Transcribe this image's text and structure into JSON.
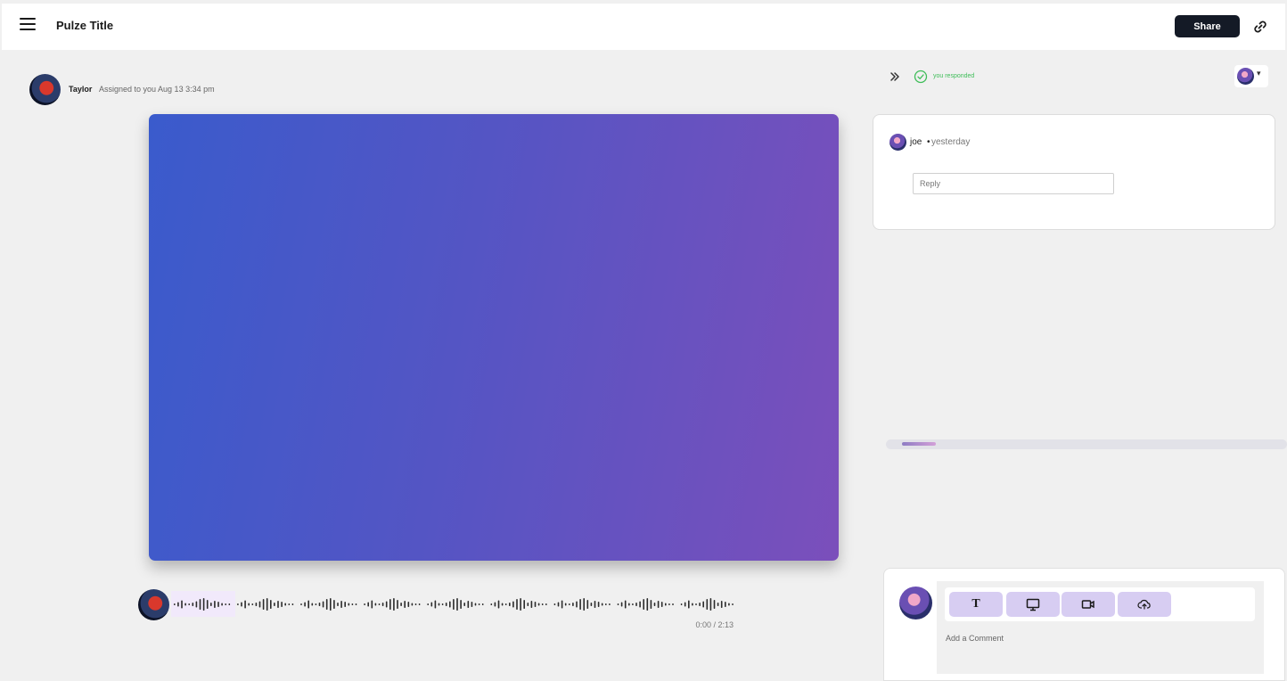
{
  "header": {
    "title": "Pulze Title",
    "share_label": "Share",
    "menu_icon": "hamburger-menu-icon",
    "link_icon": "link-icon"
  },
  "post": {
    "author": "Taylor",
    "meta": "Assigned to you Aug 13 3:34 pm"
  },
  "video": {
    "gradient_start": "#3a5bcc",
    "gradient_end": "#7b4fbb"
  },
  "audio": {
    "time": "0:00 / 2:13",
    "progress": 0.11
  },
  "panel": {
    "status": "you responded",
    "status_color": "#3ebd58",
    "comment": {
      "author": "joe",
      "separator": "•",
      "time": "yesterday",
      "reply_placeholder": "Reply"
    },
    "compose": {
      "placeholder": "Add a Comment",
      "tools": [
        {
          "name": "text",
          "icon": "text-icon"
        },
        {
          "name": "screen",
          "icon": "monitor-icon"
        },
        {
          "name": "video",
          "icon": "video-camera-icon"
        },
        {
          "name": "upload",
          "icon": "cloud-upload-icon"
        }
      ],
      "tool_color": "#d7cdf2"
    }
  }
}
